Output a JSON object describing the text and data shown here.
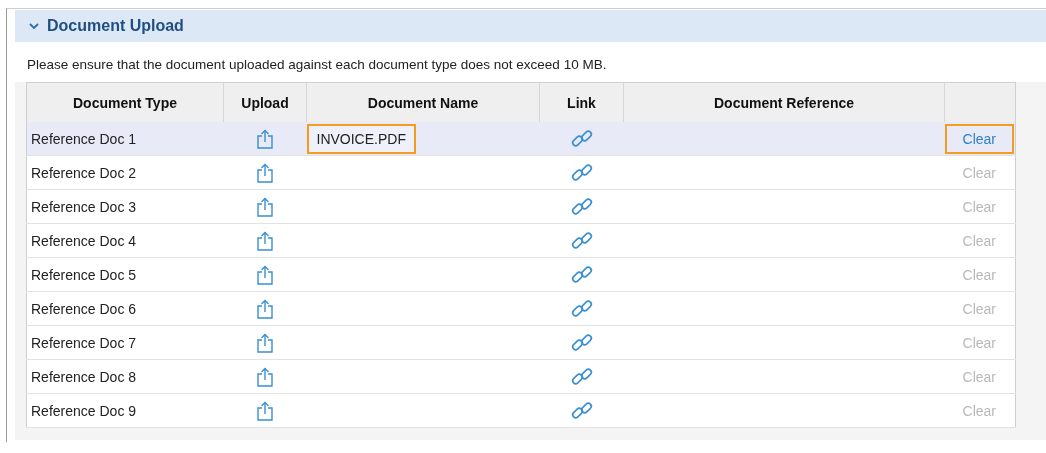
{
  "section": {
    "title": "Document Upload",
    "expanded": true
  },
  "note": "Please ensure that the document uploaded against each document type does not exceed 10 MB.",
  "table": {
    "columns": [
      "Document Type",
      "Upload",
      "Document Name",
      "Link",
      "Document Reference"
    ],
    "rows": [
      {
        "type": "Reference Doc 1",
        "name": "INVOICE.PDF",
        "name_highlighted": true,
        "selected": true,
        "clear": {
          "label": "Clear",
          "disabled": false,
          "highlighted": true
        }
      },
      {
        "type": "Reference Doc 2",
        "selected": false,
        "clear": {
          "label": "Clear",
          "disabled": true,
          "highlighted": false
        }
      },
      {
        "type": "Reference Doc 3",
        "selected": false,
        "clear": {
          "label": "Clear",
          "disabled": true,
          "highlighted": false
        }
      },
      {
        "type": "Reference Doc 4",
        "selected": false,
        "clear": {
          "label": "Clear",
          "disabled": true,
          "highlighted": false
        }
      },
      {
        "type": "Reference Doc 5",
        "selected": false,
        "clear": {
          "label": "Clear",
          "disabled": true,
          "highlighted": false
        }
      },
      {
        "type": "Reference Doc 6",
        "selected": false,
        "clear": {
          "label": "Clear",
          "disabled": true,
          "highlighted": false
        }
      },
      {
        "type": "Reference Doc 7",
        "selected": false,
        "clear": {
          "label": "Clear",
          "disabled": true,
          "highlighted": false
        }
      },
      {
        "type": "Reference Doc 8",
        "selected": false,
        "clear": {
          "label": "Clear",
          "disabled": true,
          "highlighted": false
        }
      },
      {
        "type": "Reference Doc 9",
        "selected": false,
        "clear": {
          "label": "Clear",
          "disabled": true,
          "highlighted": false
        }
      }
    ]
  }
}
